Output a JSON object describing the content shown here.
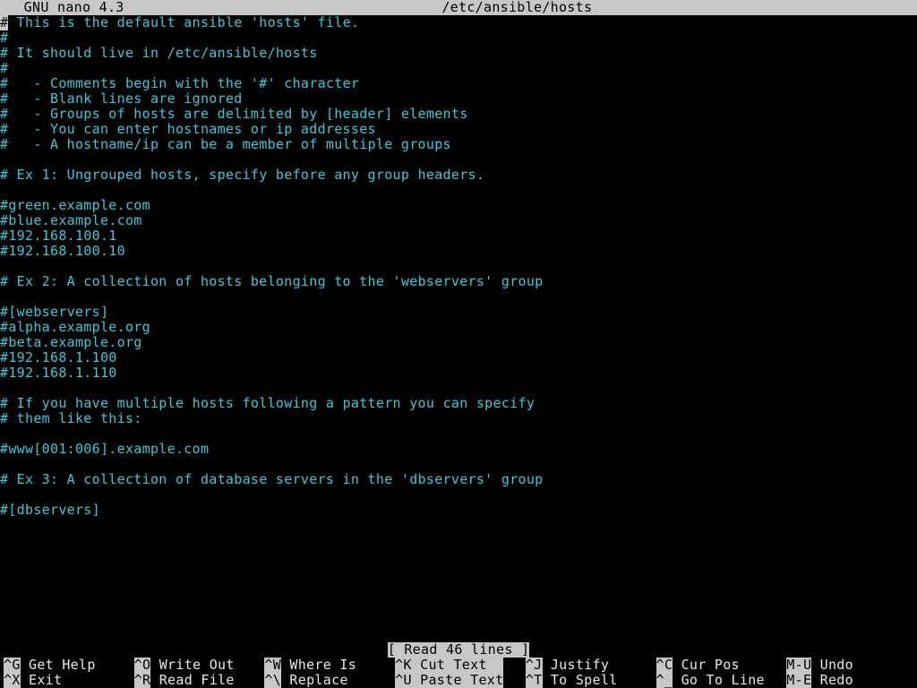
{
  "titlebar": {
    "app": "  GNU nano 4.3",
    "filename": "/etc/ansible/hosts"
  },
  "file_lines": [
    "# This is the default ansible 'hosts' file.",
    "#",
    "# It should live in /etc/ansible/hosts",
    "#",
    "#   - Comments begin with the '#' character",
    "#   - Blank lines are ignored",
    "#   - Groups of hosts are delimited by [header] elements",
    "#   - You can enter hostnames or ip addresses",
    "#   - A hostname/ip can be a member of multiple groups",
    "",
    "# Ex 1: Ungrouped hosts, specify before any group headers.",
    "",
    "#green.example.com",
    "#blue.example.com",
    "#192.168.100.1",
    "#192.168.100.10",
    "",
    "# Ex 2: A collection of hosts belonging to the 'webservers' group",
    "",
    "#[webservers]",
    "#alpha.example.org",
    "#beta.example.org",
    "#192.168.1.100",
    "#192.168.1.110",
    "",
    "# If you have multiple hosts following a pattern you can specify",
    "# them like this:",
    "",
    "#www[001:006].example.com",
    "",
    "# Ex 3: A collection of database servers in the 'dbservers' group",
    "",
    "#[dbservers]",
    ""
  ],
  "status": "[ Read 46 lines ]",
  "shortcuts": [
    {
      "key": "^G",
      "label": " Get Help",
      "hl": false
    },
    {
      "key": "^X",
      "label": " Exit",
      "hl": false
    },
    {
      "key": "^O",
      "label": " Write Out",
      "hl": false
    },
    {
      "key": "^R",
      "label": " Read File",
      "hl": false
    },
    {
      "key": "^W",
      "label": " Where Is",
      "hl": false
    },
    {
      "key": "^\\",
      "label": " Replace",
      "hl": false
    },
    {
      "key": "^K",
      "label": " Cut Text  ",
      "hl": true
    },
    {
      "key": "^U",
      "label": " Paste Text",
      "hl": true
    },
    {
      "key": "^J",
      "label": " Justify",
      "hl": false
    },
    {
      "key": "^T",
      "label": " To Spell",
      "hl": false
    },
    {
      "key": "^C",
      "label": " Cur Pos",
      "hl": false
    },
    {
      "key": "^_",
      "label": " Go To Line",
      "hl": false
    },
    {
      "key": "M-U",
      "label": " Undo",
      "hl": false
    },
    {
      "key": "M-E",
      "label": " Redo",
      "hl": false
    }
  ]
}
